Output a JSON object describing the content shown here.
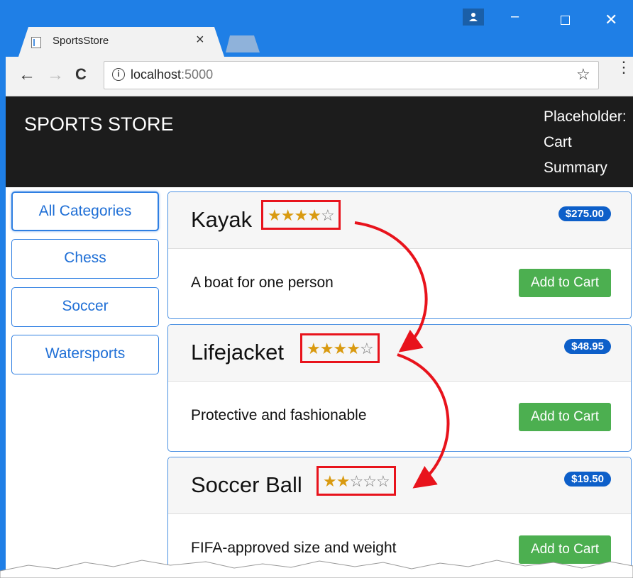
{
  "browser": {
    "tab_title": "SportsStore",
    "tab_close": "×",
    "url_host": "localhost",
    "url_port": ":5000",
    "icons": [
      "file-icon",
      "back-arrow-icon",
      "forward-arrow-icon",
      "reload-icon",
      "info-icon",
      "star-icon",
      "menu-dots-icon",
      "profile-icon",
      "minimize-icon",
      "maximize-icon",
      "close-icon"
    ]
  },
  "header": {
    "brand": "SPORTS STORE",
    "cart_line1": "Placeholder:",
    "cart_line2": "Cart",
    "cart_line3": "Summary"
  },
  "categories": [
    "All Categories",
    "Chess",
    "Soccer",
    "Watersports"
  ],
  "products": [
    {
      "name": "Kayak",
      "rating": 4,
      "max_rating": 5,
      "price": "$275.00",
      "description": "A boat for one person",
      "button": "Add to Cart"
    },
    {
      "name": "Lifejacket",
      "rating": 4,
      "max_rating": 5,
      "price": "$48.95",
      "description": "Protective and fashionable",
      "button": "Add to Cart"
    },
    {
      "name": "Soccer Ball",
      "rating": 2,
      "max_rating": 5,
      "price": "$19.50",
      "description": "FIFA-approved size and weight",
      "button": "Add to Cart"
    }
  ],
  "colors": {
    "accent": "#1f7fe6",
    "header_bg": "#1c1c1c",
    "price_badge": "#0d5fc9",
    "add_button": "#4caf50",
    "star": "#d99a10",
    "highlight": "#e8131c"
  }
}
